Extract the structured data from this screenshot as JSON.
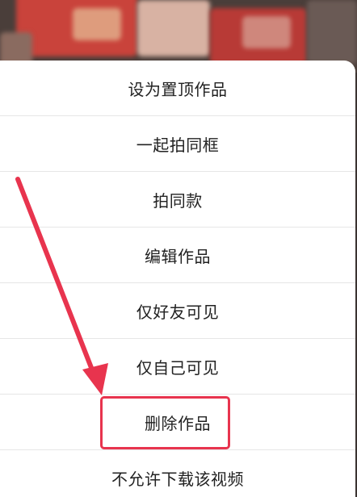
{
  "menu": {
    "items": [
      {
        "label": "设为置顶作品"
      },
      {
        "label": "一起拍同框"
      },
      {
        "label": "拍同款"
      },
      {
        "label": "编辑作品"
      },
      {
        "label": "仅好友可见"
      },
      {
        "label": "仅自己可见"
      },
      {
        "label": "删除作品"
      },
      {
        "label": "不允许下载该视频"
      }
    ]
  },
  "annotation": {
    "color": "#e8344e",
    "highlighted_item": "删除作品"
  }
}
